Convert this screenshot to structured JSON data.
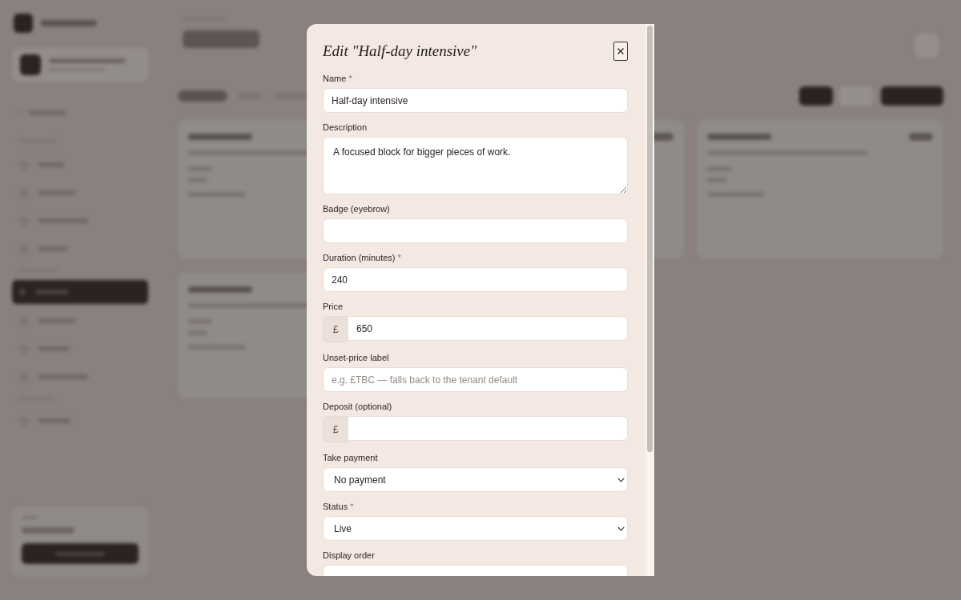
{
  "dialog": {
    "title": "Edit \"Half-day intensive\"",
    "fields": [
      {
        "kind": "text",
        "label": "Name",
        "mark": "*",
        "value": "Half-day intensive"
      },
      {
        "kind": "textarea",
        "label": "Description",
        "value": "A focused block for bigger pieces of work."
      },
      {
        "kind": "text",
        "label": "Badge (eyebrow)"
      },
      {
        "kind": "text",
        "label": "Duration (minutes)",
        "mark": "*",
        "value": "240"
      },
      {
        "kind": "currency",
        "label": "Price",
        "prefix": "£",
        "value": "650"
      },
      {
        "kind": "text",
        "label": "Unset-price label",
        "placeholder": "e.g. £TBC — falls back to the tenant default"
      },
      {
        "kind": "currency",
        "label": "Deposit (optional)",
        "prefix": "£"
      },
      {
        "kind": "select",
        "label": "Take payment",
        "value": "No payment"
      },
      {
        "kind": "select",
        "label": "Status",
        "mark": "*",
        "value": "Live"
      },
      {
        "kind": "text",
        "label": "Display order"
      }
    ]
  }
}
